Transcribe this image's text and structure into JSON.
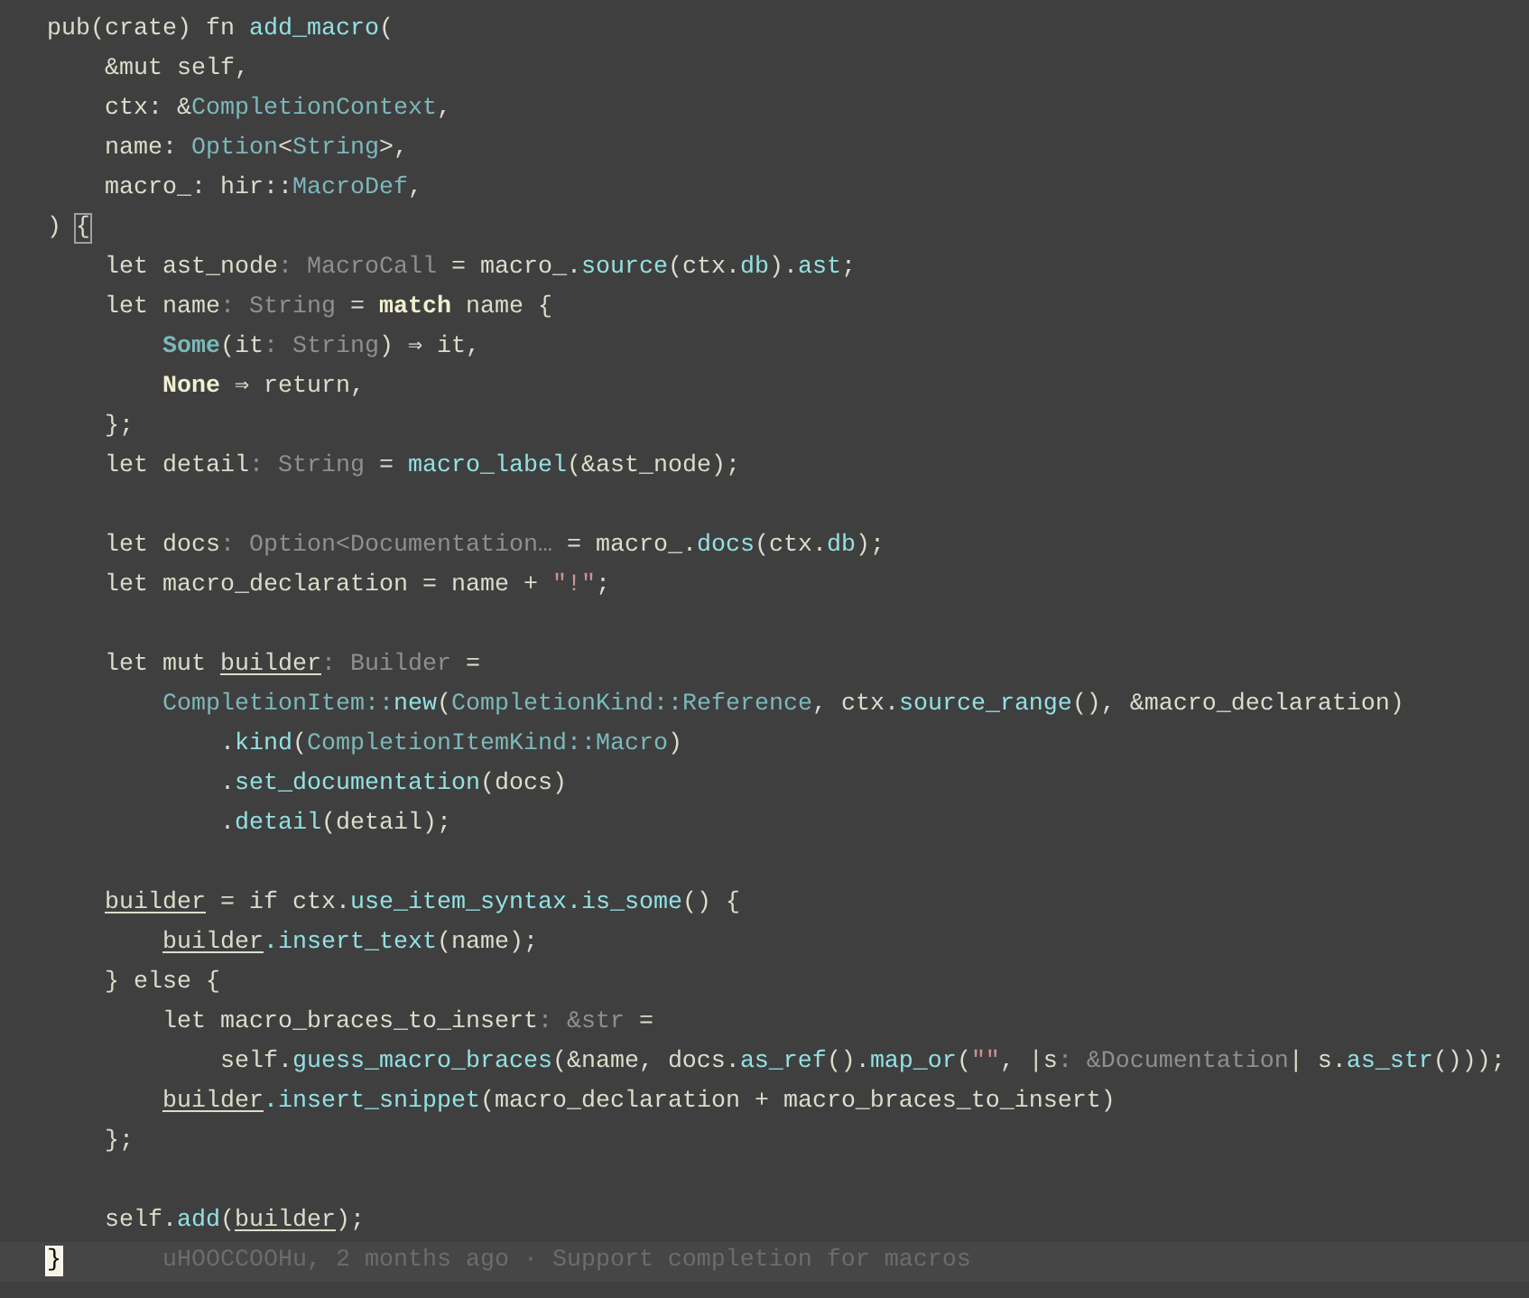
{
  "editor": {
    "blocks": [
      {
        "lines": [
          {
            "tokens": [
              {
                "text": "pub(crate) fn ",
                "kind": "plain"
              },
              {
                "text": "add_macro",
                "kind": "fn"
              },
              {
                "text": "(",
                "kind": "plain"
              }
            ]
          },
          {
            "tokens": [
              {
                "text": "    &mut self,",
                "kind": "plain"
              }
            ]
          },
          {
            "tokens": [
              {
                "text": "    ctx: &",
                "kind": "plain"
              },
              {
                "text": "CompletionContext",
                "kind": "type"
              },
              {
                "text": ",",
                "kind": "plain"
              }
            ]
          },
          {
            "tokens": [
              {
                "text": "    name: ",
                "kind": "plain"
              },
              {
                "text": "Option",
                "kind": "type"
              },
              {
                "text": "<",
                "kind": "plain"
              },
              {
                "text": "String",
                "kind": "type"
              },
              {
                "text": ">,",
                "kind": "plain"
              }
            ]
          },
          {
            "tokens": [
              {
                "text": "    macro_: hir::",
                "kind": "plain"
              },
              {
                "text": "MacroDef",
                "kind": "type"
              },
              {
                "text": ",",
                "kind": "plain"
              }
            ]
          },
          {
            "tokens": [
              {
                "text": ") ",
                "kind": "plain"
              },
              {
                "text": "{",
                "kind": "brace"
              }
            ]
          },
          {
            "tokens": [
              {
                "text": "    let ast_node",
                "kind": "plain"
              },
              {
                "text": ": MacroCall",
                "kind": "hint"
              },
              {
                "text": " = macro_.",
                "kind": "plain"
              },
              {
                "text": "source",
                "kind": "fn"
              },
              {
                "text": "(ctx.",
                "kind": "plain"
              },
              {
                "text": "db",
                "kind": "fn"
              },
              {
                "text": ").",
                "kind": "plain"
              },
              {
                "text": "ast",
                "kind": "fn"
              },
              {
                "text": ";",
                "kind": "plain"
              }
            ]
          },
          {
            "tokens": [
              {
                "text": "    let name",
                "kind": "plain"
              },
              {
                "text": ": String",
                "kind": "hint"
              },
              {
                "text": " = ",
                "kind": "plain"
              },
              {
                "text": "match",
                "kind": "bold"
              },
              {
                "text": " name {",
                "kind": "plain"
              }
            ]
          },
          {
            "tokens": [
              {
                "text": "        Some",
                "kind": "variant"
              },
              {
                "text": "(it",
                "kind": "plain"
              },
              {
                "text": ": String",
                "kind": "hint"
              },
              {
                "text": ") ⇒ it,",
                "kind": "plain"
              }
            ]
          },
          {
            "tokens": [
              {
                "text": "        None",
                "kind": "bold"
              },
              {
                "text": " ⇒ return,",
                "kind": "plain"
              }
            ]
          },
          {
            "tokens": [
              {
                "text": "    };",
                "kind": "plain"
              }
            ]
          },
          {
            "tokens": [
              {
                "text": "    let detail",
                "kind": "plain"
              },
              {
                "text": ": String",
                "kind": "hint"
              },
              {
                "text": " = ",
                "kind": "plain"
              },
              {
                "text": "macro_label",
                "kind": "fn"
              },
              {
                "text": "(&ast_node);",
                "kind": "plain"
              }
            ]
          }
        ]
      },
      {
        "lines": [
          {
            "tokens": [
              {
                "text": "    let docs",
                "kind": "plain"
              },
              {
                "text": ": Option<Documentation…",
                "kind": "hint"
              },
              {
                "text": " = macro_.",
                "kind": "plain"
              },
              {
                "text": "docs",
                "kind": "fn"
              },
              {
                "text": "(ctx.",
                "kind": "plain"
              },
              {
                "text": "db",
                "kind": "fn"
              },
              {
                "text": ");",
                "kind": "plain"
              }
            ]
          },
          {
            "tokens": [
              {
                "text": "    let macro_declaration = name + ",
                "kind": "plain"
              },
              {
                "text": "\"!\"",
                "kind": "string"
              },
              {
                "text": ";",
                "kind": "plain"
              }
            ]
          }
        ]
      },
      {
        "lines": [
          {
            "tokens": [
              {
                "text": "    let mut ",
                "kind": "plain"
              },
              {
                "text": "builder",
                "kind": "mutable"
              },
              {
                "text": ": Builder",
                "kind": "hint"
              },
              {
                "text": " =",
                "kind": "plain"
              }
            ]
          },
          {
            "tokens": [
              {
                "text": "        CompletionItem::",
                "kind": "type"
              },
              {
                "text": "new",
                "kind": "fn"
              },
              {
                "text": "(",
                "kind": "plain"
              },
              {
                "text": "CompletionKind::Reference",
                "kind": "type"
              },
              {
                "text": ", ctx.",
                "kind": "plain"
              },
              {
                "text": "source_range",
                "kind": "fn"
              },
              {
                "text": "(), &macro_declaration)",
                "kind": "plain"
              }
            ]
          },
          {
            "tokens": [
              {
                "text": "            .",
                "kind": "plain"
              },
              {
                "text": "kind",
                "kind": "fn"
              },
              {
                "text": "(",
                "kind": "plain"
              },
              {
                "text": "CompletionItemKind::Macro",
                "kind": "type"
              },
              {
                "text": ")",
                "kind": "plain"
              }
            ]
          },
          {
            "tokens": [
              {
                "text": "            .",
                "kind": "plain"
              },
              {
                "text": "set_documentation",
                "kind": "fn"
              },
              {
                "text": "(docs)",
                "kind": "plain"
              }
            ]
          },
          {
            "tokens": [
              {
                "text": "            .",
                "kind": "plain"
              },
              {
                "text": "detail",
                "kind": "fn"
              },
              {
                "text": "(detail);",
                "kind": "plain"
              }
            ]
          }
        ]
      },
      {
        "lines": [
          {
            "tokens": [
              {
                "text": "    builder",
                "kind": "mutable"
              },
              {
                "text": " = if ctx.",
                "kind": "plain"
              },
              {
                "text": "use_item_syntax",
                "kind": "fn"
              },
              {
                "text": ".is_some",
                "kind": "fn"
              },
              {
                "text": "() {",
                "kind": "plain"
              }
            ]
          },
          {
            "tokens": [
              {
                "text": "        builder",
                "kind": "mutable"
              },
              {
                "text": ".insert_text",
                "kind": "fn"
              },
              {
                "text": "(name);",
                "kind": "plain"
              }
            ]
          },
          {
            "tokens": [
              {
                "text": "    } else {",
                "kind": "plain"
              }
            ]
          },
          {
            "tokens": [
              {
                "text": "        let macro_braces_to_insert",
                "kind": "plain"
              },
              {
                "text": ": &str",
                "kind": "hint"
              },
              {
                "text": " =",
                "kind": "plain"
              }
            ]
          },
          {
            "tokens": [
              {
                "text": "            self.",
                "kind": "plain"
              },
              {
                "text": "guess_macro_braces",
                "kind": "fn"
              },
              {
                "text": "(&name, docs.",
                "kind": "plain"
              },
              {
                "text": "as_ref",
                "kind": "fn"
              },
              {
                "text": "().",
                "kind": "plain"
              },
              {
                "text": "map_or",
                "kind": "fn"
              },
              {
                "text": "(",
                "kind": "plain"
              },
              {
                "text": "\"\"",
                "kind": "string"
              },
              {
                "text": ", |s",
                "kind": "plain"
              },
              {
                "text": ": &Documentation",
                "kind": "hint"
              },
              {
                "text": "| s.",
                "kind": "plain"
              },
              {
                "text": "as_str",
                "kind": "fn"
              },
              {
                "text": "()));",
                "kind": "plain"
              }
            ]
          },
          {
            "tokens": [
              {
                "text": "        builder",
                "kind": "mutable"
              },
              {
                "text": ".insert_snippet",
                "kind": "fn"
              },
              {
                "text": "(macro_declaration + macro_braces_to_insert)",
                "kind": "plain"
              }
            ]
          },
          {
            "tokens": [
              {
                "text": "    };",
                "kind": "plain"
              }
            ]
          }
        ]
      },
      {
        "lines": [
          {
            "tokens": [
              {
                "text": "    self.",
                "kind": "plain"
              },
              {
                "text": "add",
                "kind": "fn"
              },
              {
                "text": "(",
                "kind": "plain"
              },
              {
                "text": "builder",
                "kind": "mutable"
              },
              {
                "text": ");",
                "kind": "plain"
              }
            ]
          }
        ]
      }
    ],
    "current_line": {
      "tokens": [
        {
          "text": "}",
          "kind": "cursor"
        }
      ],
      "blame": "uHOOCCOOHu, 2 months ago · Support completion for macros"
    }
  }
}
